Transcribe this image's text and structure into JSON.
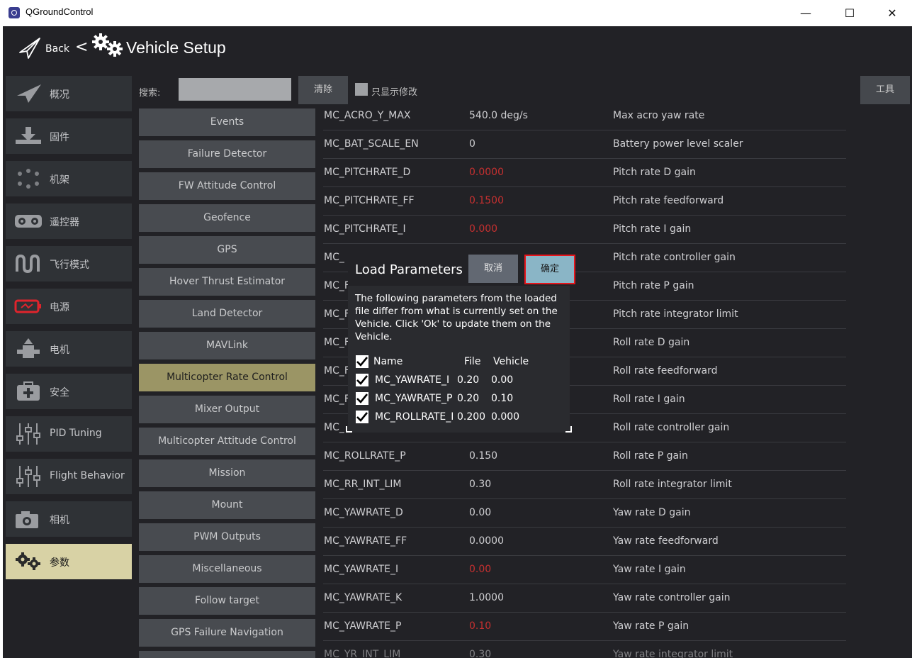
{
  "window": {
    "title": "QGroundControl",
    "minimize": "—",
    "maximize": "☐",
    "close": "✕"
  },
  "toolbar": {
    "back_label": "Back",
    "separator": "<",
    "title": "Vehicle Setup"
  },
  "sidebar": {
    "items": [
      {
        "label": "概况",
        "icon": "plane-icon"
      },
      {
        "label": "固件",
        "icon": "firmware-download-icon"
      },
      {
        "label": "机架",
        "icon": "airframe-icon"
      },
      {
        "label": "遥控器",
        "icon": "radio-controller-icon"
      },
      {
        "label": "飞行模式",
        "icon": "flight-modes-icon"
      },
      {
        "label": "电源",
        "icon": "battery-icon"
      },
      {
        "label": "电机",
        "icon": "motor-icon"
      },
      {
        "label": "安全",
        "icon": "safety-icon"
      },
      {
        "label": "PID Tuning",
        "icon": "sliders-icon"
      },
      {
        "label": "Flight Behavior",
        "icon": "sliders-icon"
      },
      {
        "label": "相机",
        "icon": "camera-icon"
      },
      {
        "label": "参数",
        "icon": "gears-icon"
      }
    ],
    "active_index": 11
  },
  "search": {
    "label": "搜索:",
    "value": "",
    "clear_label": "清除",
    "only_modified_label": "只显示修改",
    "tools_label": "工具"
  },
  "groups": {
    "items": [
      "Events",
      "Failure Detector",
      "FW Attitude Control",
      "Geofence",
      "GPS",
      "Hover Thrust Estimator",
      "Land Detector",
      "MAVLink",
      "Multicopter Rate Control",
      "Mixer Output",
      "Multicopter Attitude Control",
      "Mission",
      "Mount",
      "PWM Outputs",
      "Miscellaneous",
      "Follow target",
      "GPS Failure Navigation"
    ],
    "active_index": 8
  },
  "params": {
    "rows": [
      {
        "name": "MC_ACRO_Y_MAX",
        "value": "540.0 deg/s",
        "desc": "Max acro yaw rate",
        "modified": false
      },
      {
        "name": "MC_BAT_SCALE_EN",
        "value": "0",
        "desc": "Battery power level scaler",
        "modified": false
      },
      {
        "name": "MC_PITCHRATE_D",
        "value": "0.0000",
        "desc": "Pitch rate D gain",
        "modified": true
      },
      {
        "name": "MC_PITCHRATE_FF",
        "value": "0.1500",
        "desc": "Pitch rate feedforward",
        "modified": true
      },
      {
        "name": "MC_PITCHRATE_I",
        "value": "0.000",
        "desc": "Pitch rate I gain",
        "modified": true
      },
      {
        "name": "MC_",
        "value": "",
        "desc": "Pitch rate controller gain",
        "modified": false
      },
      {
        "name": "MC_F",
        "value": "",
        "desc": "Pitch rate P gain",
        "modified": false
      },
      {
        "name": "MC_F",
        "value": "",
        "desc": "Pitch rate integrator limit",
        "modified": false
      },
      {
        "name": "MC_F",
        "value": "",
        "desc": "Roll rate D gain",
        "modified": false
      },
      {
        "name": "MC_F",
        "value": "",
        "desc": "Roll rate feedforward",
        "modified": false
      },
      {
        "name": "MC_F",
        "value": "",
        "desc": "Roll rate I gain",
        "modified": false
      },
      {
        "name": "MC_",
        "value": "",
        "desc": "Roll rate controller gain",
        "modified": false
      },
      {
        "name": "MC_ROLLRATE_P",
        "value": "0.150",
        "desc": "Roll rate P gain",
        "modified": false
      },
      {
        "name": "MC_RR_INT_LIM",
        "value": "0.30",
        "desc": "Roll rate integrator limit",
        "modified": false
      },
      {
        "name": "MC_YAWRATE_D",
        "value": "0.00",
        "desc": "Yaw rate D gain",
        "modified": false
      },
      {
        "name": "MC_YAWRATE_FF",
        "value": "0.0000",
        "desc": "Yaw rate feedforward",
        "modified": false
      },
      {
        "name": "MC_YAWRATE_I",
        "value": "0.00",
        "desc": "Yaw rate I gain",
        "modified": true
      },
      {
        "name": "MC_YAWRATE_K",
        "value": "1.0000",
        "desc": "Yaw rate controller gain",
        "modified": false
      },
      {
        "name": "MC_YAWRATE_P",
        "value": "0.10",
        "desc": "Yaw rate P gain",
        "modified": true
      },
      {
        "name": "MC_YR_INT_LIM",
        "value": "0.30",
        "desc": "Yaw rate integrator limit",
        "modified": false
      }
    ]
  },
  "dialog": {
    "title": "Load Parameters",
    "cancel_label": "取消",
    "ok_label": "确定",
    "message": "The following parameters from the loaded file differ from what is currently set on the Vehicle. Click 'Ok' to update them on the Vehicle.",
    "columns": {
      "name": "Name",
      "file": "File",
      "vehicle": "Vehicle"
    },
    "rows": [
      {
        "name": "MC_YAWRATE_I",
        "file": "0.20",
        "vehicle": "0.00",
        "checked": true
      },
      {
        "name": "MC_YAWRATE_P",
        "file": "0.20",
        "vehicle": "0.10",
        "checked": true
      },
      {
        "name": "MC_ROLLRATE_I",
        "file": "0.200",
        "vehicle": "0.000",
        "checked": true
      }
    ]
  },
  "colors": {
    "background": "#222226",
    "sidebar_item": "#2f3236",
    "sidebar_active": "#d8d2a5",
    "group_button": "#484b50",
    "group_active": "#9b9565",
    "modified_value": "#c63030",
    "ok_button": "#8ab5c6",
    "highlight_border": "#e6151b"
  }
}
